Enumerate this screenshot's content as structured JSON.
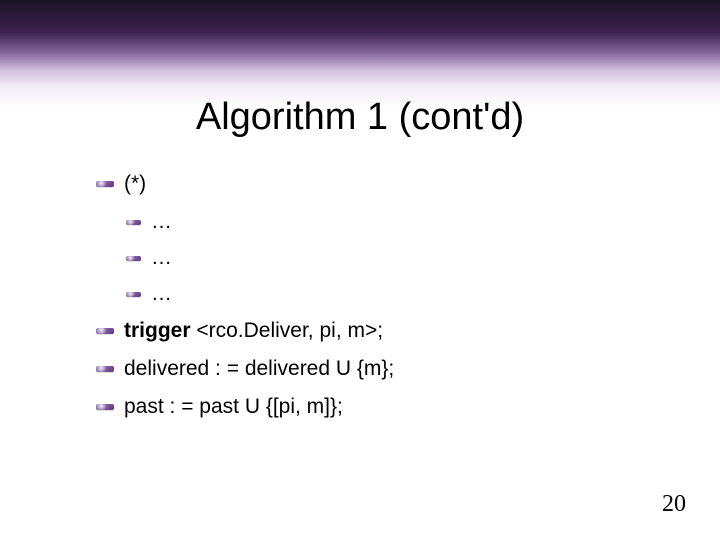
{
  "title": "Algorithm 1 (cont'd)",
  "lines": {
    "l0": "(*)",
    "l1": "…",
    "l2": "…",
    "l3": "…",
    "l4_b": "trigger",
    "l4_r": " <rco.Deliver, pi, m>;",
    "l5": "delivered : = delivered U {m};",
    "l6": "past : = past U {[pi, m]};"
  },
  "page_number": "20"
}
